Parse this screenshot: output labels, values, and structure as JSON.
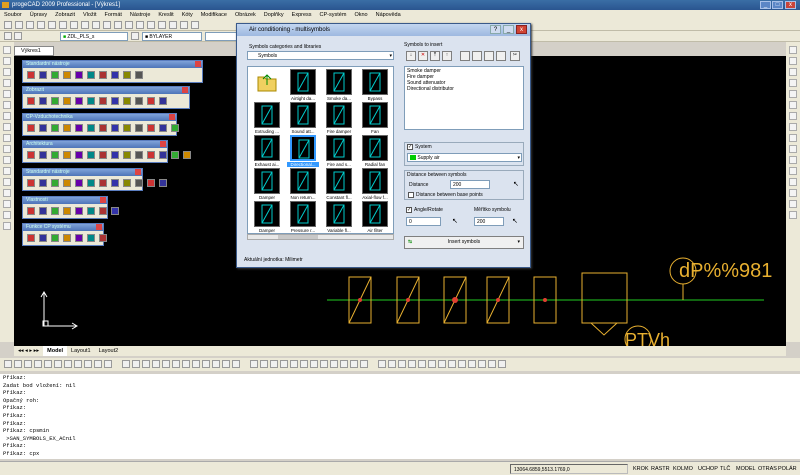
{
  "window": {
    "title": "progeCAD 2009 Professional - [Výkres1]"
  },
  "menu": [
    "Soubor",
    "Úpravy",
    "Zobrazit",
    "Vložit",
    "Formát",
    "Nástroje",
    "Kreslit",
    "Kóty",
    "Modifikace",
    "Obrázek",
    "Doplňky",
    "Express",
    "CP-systém",
    "Okno",
    "Nápověda"
  ],
  "toolbar": {
    "layer": "ZDL_PLS_s",
    "color": "BYLAYER"
  },
  "drawing": {
    "tab_label": "Výkres1"
  },
  "palettes": [
    {
      "title": "Standardní nástroje"
    },
    {
      "title": "Zobrazit"
    },
    {
      "title": "CP-Vzduchotechnika"
    },
    {
      "title": "Architektura"
    },
    {
      "title": "Standardní nástroje"
    },
    {
      "title": "Vlastnosti"
    },
    {
      "title": "Funkce CP systému"
    }
  ],
  "dialog": {
    "title": "Air conditioning - multisymbols",
    "categories_label": "Symbols categories and libraries",
    "category_value": "Symbols",
    "symbols": [
      {
        "label": ""
      },
      {
        "label": "Airtight da..."
      },
      {
        "label": "Smoke da..."
      },
      {
        "label": "Bypass"
      },
      {
        "label": "Extruding ..."
      },
      {
        "label": "Sound att..."
      },
      {
        "label": "Fire damper"
      },
      {
        "label": "Fan"
      },
      {
        "label": "Exhaust ai..."
      },
      {
        "label": "Directional..."
      },
      {
        "label": "Fire and s..."
      },
      {
        "label": "Radial fan"
      },
      {
        "label": "Damper"
      },
      {
        "label": "Non return..."
      },
      {
        "label": "Constant fl..."
      },
      {
        "label": "Axial-flow f..."
      },
      {
        "label": "Damper"
      },
      {
        "label": "Pressure r..."
      },
      {
        "label": "Variable fl..."
      },
      {
        "label": "Air filter"
      }
    ],
    "selected_symbol_index": 9,
    "symbols_to_insert_label": "Symbols to insert",
    "insert_list": [
      "Smoke damper",
      "Fire damper",
      "Sound attenuator",
      "Directional distributor"
    ],
    "system_label": "System",
    "system_checked": true,
    "system_value": "Supply air",
    "system_color": "#00cc00",
    "distance_group_label": "Distance between symbols",
    "distance_label": "Distance",
    "distance_value": "200",
    "base_points_label": "Distance between base points",
    "angle_label": "Angle/Rotate",
    "angle_value": "0",
    "scale_label": "Měřítko symbolu",
    "scale_value": "200",
    "insert_button": "Insert symbols",
    "units_label": "Aktuální jednotka:",
    "units_value": "Milimetr"
  },
  "drawing_text": {
    "dp_label": "dP%%981",
    "ptv_label": "PTVh"
  },
  "model_tabs": [
    "Model",
    "Layout1",
    "Layout2"
  ],
  "command_lines": [
    "Příkaz:",
    "Zadat bod vložení: nil",
    "Příkaz:",
    "Opačný roh:",
    "Příkaz:",
    "Příkaz:",
    "Příkaz:",
    "Příkaz: cpsmin",
    " >SAN_SYMBOLS_EX_ACnil",
    "Příkaz:",
    "Příkaz: cpx"
  ],
  "status": {
    "coords": "13064.6859,5513.1769,0",
    "toggles": [
      "KROK",
      "RASTR",
      "KOLMO",
      "UCHOP",
      "TLČ",
      "MODEL",
      "OTRAS",
      "POLÁR"
    ]
  }
}
